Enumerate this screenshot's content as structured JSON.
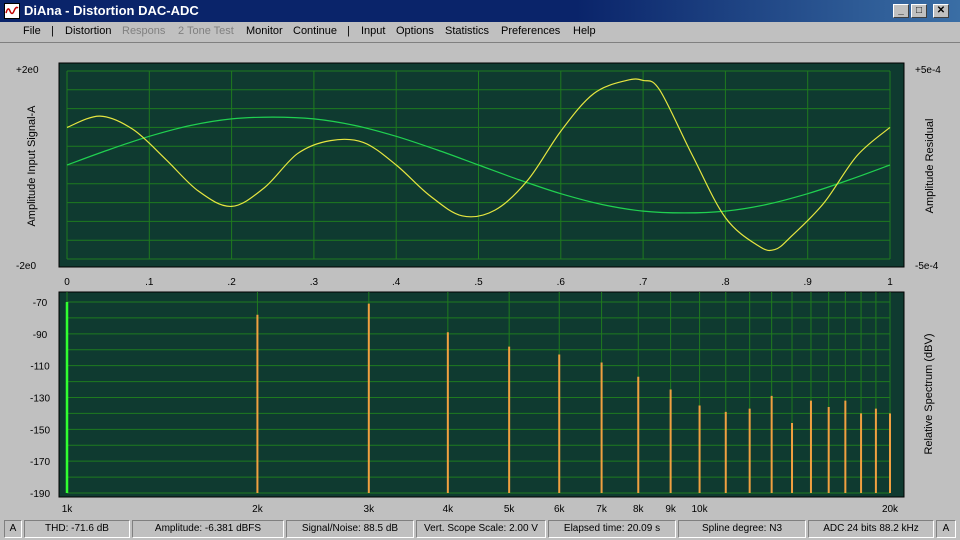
{
  "window": {
    "title": "DiAna - Distortion DAC-ADC",
    "controls": [
      "_",
      "□",
      "✕"
    ]
  },
  "menu": [
    {
      "label": "File",
      "enabled": true
    },
    {
      "label": "|",
      "enabled": true
    },
    {
      "label": "Distortion",
      "enabled": true
    },
    {
      "label": "Respons",
      "enabled": false
    },
    {
      "label": "2 Tone Test",
      "enabled": false
    },
    {
      "label": "Monitor",
      "enabled": true
    },
    {
      "label": "Continue",
      "enabled": true
    },
    {
      "label": "|",
      "enabled": true
    },
    {
      "label": "Input",
      "enabled": true
    },
    {
      "label": "Options",
      "enabled": true
    },
    {
      "label": "Statistics",
      "enabled": true
    },
    {
      "label": "Preferences",
      "enabled": true
    },
    {
      "label": "Help",
      "enabled": true
    }
  ],
  "scope": {
    "left_axis_top": "+2e0",
    "left_axis_bottom": "-2e0",
    "left_axis_label": "Amplitude Input Signal-A",
    "right_axis_top": "+5e-4",
    "right_axis_bottom": "-5e-4",
    "right_axis_label": "Amplitude Residual",
    "x_ticks": [
      "0",
      ".1",
      ".2",
      ".3",
      ".4",
      ".5",
      ".6",
      ".7",
      ".8",
      ".9",
      "1"
    ]
  },
  "spectrum": {
    "y_ticks": [
      "-70",
      "-90",
      "-110",
      "-130",
      "-150",
      "-170",
      "-190"
    ],
    "right_axis_label": "Relative Spectrum (dBV)",
    "x_ticks": [
      "1k",
      "2k",
      "3k",
      "4k",
      "5k",
      "6k",
      "7k",
      "8k",
      "9k",
      "10k",
      "20k"
    ]
  },
  "colors": {
    "plot_bg": "#0f3a30",
    "grid": "#1f7a1f",
    "signal": "#20d050",
    "residual": "#e6e640",
    "harmonic": "#f0a040",
    "fundamental": "#30ff30"
  },
  "chart_data": [
    {
      "type": "line",
      "title": "",
      "xlabel": "",
      "ylabel": "Amplitude Input Signal-A",
      "xlim": [
        0,
        1
      ],
      "ylim": [
        -2,
        2
      ],
      "y2label": "Amplitude Residual",
      "y2lim": [
        -0.0005,
        0.0005
      ],
      "grid": true,
      "series": [
        {
          "name": "",
          "axis": "left",
          "x": [
            0,
            0.05,
            0.1,
            0.15,
            0.2,
            0.25,
            0.3,
            0.35,
            0.4,
            0.45,
            0.5,
            0.55,
            0.6,
            0.65,
            0.7,
            0.75,
            0.8,
            0.85,
            0.9,
            0.95,
            1.0
          ],
          "y": [
            0,
            0.32,
            0.61,
            0.84,
            0.98,
            1.02,
            0.98,
            0.84,
            0.61,
            0.32,
            0,
            -0.32,
            -0.61,
            -0.84,
            -0.98,
            -1.02,
            -0.98,
            -0.84,
            -0.61,
            -0.32,
            0
          ]
        },
        {
          "name": "",
          "axis": "right",
          "x": [
            0,
            0.04,
            0.08,
            0.12,
            0.16,
            0.2,
            0.24,
            0.28,
            0.32,
            0.36,
            0.4,
            0.44,
            0.48,
            0.52,
            0.56,
            0.6,
            0.64,
            0.68,
            0.7,
            0.72,
            0.76,
            0.8,
            0.84,
            0.86,
            0.88,
            0.92,
            0.96,
            1.0
          ],
          "y": [
            0.0002,
            0.00026,
            0.00019,
            3e-05,
            -0.00014,
            -0.00022,
            -0.00012,
            6e-05,
            0.00013,
            0.00012,
            0.0,
            -0.00016,
            -0.00027,
            -0.00024,
            -8e-05,
            0.00018,
            0.00038,
            0.00045,
            0.00045,
            0.0004,
            5e-05,
            -0.00028,
            -0.00043,
            -0.00045,
            -0.00038,
            -0.0002,
            5e-05,
            0.0002
          ]
        }
      ]
    },
    {
      "type": "bar",
      "title": "",
      "xlabel": "",
      "ylabel": "Relative Spectrum (dBV)",
      "x_scale": "log",
      "xlim": [
        1000,
        20000
      ],
      "ylim": [
        -190,
        -70
      ],
      "grid": true,
      "fundamental": {
        "x": 1000,
        "y": -70
      },
      "x": [
        2000,
        3000,
        4000,
        5000,
        6000,
        7000,
        8000,
        9000,
        10000,
        11000,
        12000,
        13000,
        14000,
        15000,
        16000,
        17000,
        18000,
        19000,
        20000
      ],
      "values": [
        -78,
        -71,
        -89,
        -98,
        -103,
        -108,
        -117,
        -125,
        -135,
        -139,
        -137,
        -129,
        -146,
        -132,
        -136,
        -132,
        -140,
        -137,
        -140
      ]
    }
  ],
  "status": [
    {
      "label": "A"
    },
    {
      "label": "THD:  -71.6 dB"
    },
    {
      "label": "Amplitude: -6.381 dBFS"
    },
    {
      "label": "Signal/Noise:  88.5 dB"
    },
    {
      "label": "Vert. Scope Scale: 2.00 V"
    },
    {
      "label": "Elapsed time: 20.09 s"
    },
    {
      "label": "Spline degree: N3"
    },
    {
      "label": "ADC 24 bits 88.2 kHz"
    },
    {
      "label": "A"
    }
  ]
}
